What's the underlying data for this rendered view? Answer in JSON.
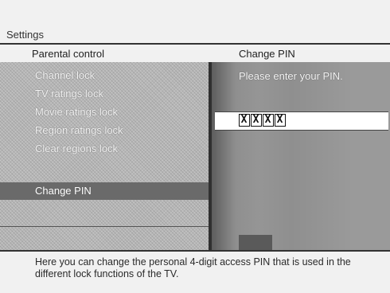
{
  "header": {
    "title": "Settings"
  },
  "left_panel": {
    "header": "Parental control",
    "items": [
      {
        "label": "Channel lock"
      },
      {
        "label": "TV ratings lock"
      },
      {
        "label": "Movie ratings lock"
      },
      {
        "label": "Region ratings lock"
      },
      {
        "label": "Clear regions lock"
      },
      {
        "label": "Change PIN",
        "selected": true
      }
    ]
  },
  "right_panel": {
    "header": "Change PIN",
    "prompt": "Please enter your PIN.",
    "pin_mask": [
      "X",
      "X",
      "X",
      "X"
    ]
  },
  "help": {
    "text": "Here you can change the personal 4-digit access PIN that is used in the different lock functions of the TV."
  }
}
